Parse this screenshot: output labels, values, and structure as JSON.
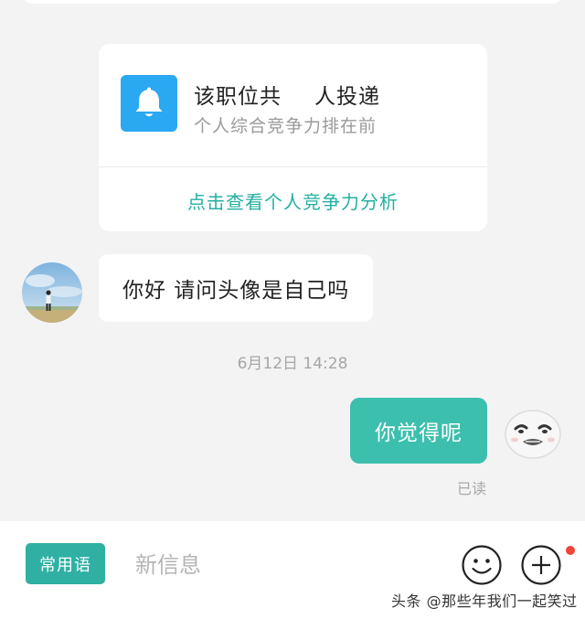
{
  "notice_card": {
    "icon": "bell-icon",
    "icon_color": "#2aa8f2",
    "title_part1": "该职位共",
    "title_part2": "人投递",
    "subtitle": "个人综合竞争力排在前",
    "link_label": "点击查看个人竞争力分析",
    "link_color": "#23b0a0"
  },
  "messages": {
    "received_text": "你好 请问头像是自己吗",
    "timestamp": "6月12日 14:28",
    "sent_text": "你觉得呢",
    "sent_bubble_color": "#3dbfae",
    "read_status": "已读"
  },
  "input_bar": {
    "phrases_button": "常用语",
    "placeholder": "新信息",
    "emoji_icon": "smiley-icon",
    "plus_icon": "plus-circle-icon",
    "notification_dot_color": "#f2443a"
  },
  "watermark": "头条 @那些年我们一起笑过"
}
